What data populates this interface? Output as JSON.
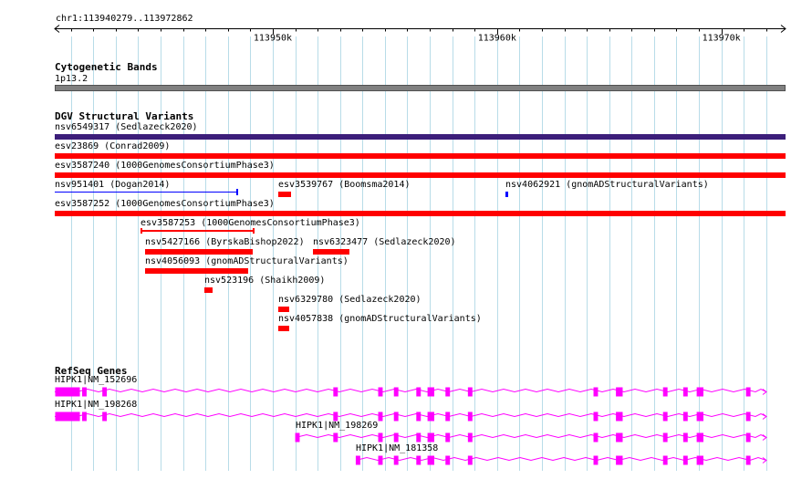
{
  "ruler": {
    "location": "chr1:113940279..113972862",
    "start": 113940279,
    "end": 113972862,
    "ticks": [
      {
        "pos": 113950000,
        "label": "113950k"
      },
      {
        "pos": 113960000,
        "label": "113960k"
      },
      {
        "pos": 113970000,
        "label": "113970k"
      }
    ]
  },
  "colors": {
    "grid": "#b8dce8",
    "band": "#808080",
    "purple": "#3c1e7a",
    "red": "#ff0000",
    "blue": "#0000ff",
    "magenta": "#ff00ff"
  },
  "tracks": {
    "cytoband": {
      "title": "Cytogenetic Bands",
      "band_label": "1p13.2"
    },
    "dgv": {
      "title": "DGV Structural Variants",
      "features": [
        {
          "label": "nsv6549317 (Sedlazeck2020)",
          "color": "purple",
          "start": 113940279,
          "end": 113972862,
          "row": 0
        },
        {
          "label": "esv23869 (Conrad2009)",
          "color": "red",
          "start": 113940279,
          "end": 113972862,
          "row": 1
        },
        {
          "label": "esv3587240 (1000GenomesConsortiumPhase3)",
          "color": "red",
          "start": 113940279,
          "end": 113972862,
          "row": 2
        },
        {
          "label": "nsv951401 (Dogan2014)",
          "color": "blue",
          "style": "line",
          "start": 113940279,
          "end": 113948400,
          "row": 3
        },
        {
          "label": "esv3539767 (Boomsma2014)",
          "color": "red",
          "start": 113950240,
          "end": 113950800,
          "row": 3
        },
        {
          "label": "nsv4062921 (gnomADStructuralVariants)",
          "color": "blue",
          "start": 113960360,
          "end": 113960500,
          "row": 3
        },
        {
          "label": "esv3587252 (1000GenomesConsortiumPhase3)",
          "color": "red",
          "start": 113940279,
          "end": 113972862,
          "row": 4
        },
        {
          "label": "esv3587253 (1000GenomesConsortiumPhase3)",
          "color": "red",
          "style": "bracket",
          "start": 113944100,
          "end": 113949200,
          "row": 5
        },
        {
          "label": "nsv5427166 (ByrskaBishop2022)",
          "color": "red",
          "start": 113944300,
          "end": 113949100,
          "row": 6
        },
        {
          "label": "nsv6323477 (Sedlazeck2020)",
          "color": "red",
          "start": 113951800,
          "end": 113953400,
          "row": 6
        },
        {
          "label": "nsv4056093 (gnomADStructuralVariants)",
          "color": "red",
          "start": 113944300,
          "end": 113948900,
          "row": 7
        },
        {
          "label": "nsv523196 (Shaikh2009)",
          "color": "red",
          "start": 113946970,
          "end": 113947300,
          "row": 8
        },
        {
          "label": "nsv6329780 (Sedlazeck2020)",
          "color": "red",
          "start": 113950240,
          "end": 113950740,
          "row": 9
        },
        {
          "label": "nsv4057838 (gnomADStructuralVariants)",
          "color": "red",
          "start": 113950240,
          "end": 113950740,
          "row": 10
        }
      ]
    },
    "refseq": {
      "title": "RefSeq Genes",
      "transcripts": [
        {
          "label": "HIPK1|NM_152696",
          "start": 113940279,
          "end": 113972000,
          "full": true,
          "exons": [
            [
              113940300,
              113941400
            ],
            [
              113941500,
              113941700
            ],
            [
              113942400,
              113942600
            ],
            [
              113952700,
              113952900
            ],
            [
              113954700,
              113954900
            ],
            [
              113955400,
              113955600
            ],
            [
              113956400,
              113956600
            ],
            [
              113956900,
              113957200
            ],
            [
              113957700,
              113957900
            ],
            [
              113958700,
              113958900
            ],
            [
              113964300,
              113964500
            ],
            [
              113965300,
              113965600
            ],
            [
              113967400,
              113967600
            ],
            [
              113968300,
              113968500
            ],
            [
              113968900,
              113969200
            ],
            [
              113971100,
              113971300
            ]
          ]
        },
        {
          "label": "HIPK1|NM_198268",
          "start": 113940279,
          "end": 113972000,
          "full": false,
          "exons": [
            [
              113940300,
              113941400
            ],
            [
              113941500,
              113941700
            ],
            [
              113942400,
              113942600
            ],
            [
              113952700,
              113952900
            ],
            [
              113954700,
              113954900
            ],
            [
              113955400,
              113955600
            ],
            [
              113956400,
              113956600
            ],
            [
              113956900,
              113957200
            ],
            [
              113957700,
              113957900
            ],
            [
              113958700,
              113958900
            ],
            [
              113964300,
              113964500
            ],
            [
              113965300,
              113965600
            ],
            [
              113967400,
              113967600
            ],
            [
              113968300,
              113968500
            ],
            [
              113968900,
              113969200
            ],
            [
              113971100,
              113971300
            ]
          ]
        },
        {
          "label": "HIPK1|NM_198269",
          "start": 113951000,
          "end": 113972000,
          "full": false,
          "exons": [
            [
              113951000,
              113951200
            ],
            [
              113952700,
              113952900
            ],
            [
              113954700,
              113954900
            ],
            [
              113955400,
              113955600
            ],
            [
              113956400,
              113956600
            ],
            [
              113956900,
              113957200
            ],
            [
              113957700,
              113957900
            ],
            [
              113958700,
              113958900
            ],
            [
              113964300,
              113964500
            ],
            [
              113965300,
              113965600
            ],
            [
              113967400,
              113967600
            ],
            [
              113968300,
              113968500
            ],
            [
              113968900,
              113969200
            ],
            [
              113971100,
              113971300
            ]
          ]
        },
        {
          "label": "HIPK1|NM_181358",
          "start": 113953700,
          "end": 113972000,
          "full": false,
          "exons": [
            [
              113953700,
              113953900
            ],
            [
              113954700,
              113954900
            ],
            [
              113955400,
              113955600
            ],
            [
              113956400,
              113956600
            ],
            [
              113956900,
              113957200
            ],
            [
              113957700,
              113957900
            ],
            [
              113958700,
              113958900
            ],
            [
              113964300,
              113964500
            ],
            [
              113965300,
              113965600
            ],
            [
              113967400,
              113967600
            ],
            [
              113968300,
              113968500
            ],
            [
              113968900,
              113969200
            ],
            [
              113971100,
              113971300
            ]
          ]
        }
      ]
    }
  }
}
